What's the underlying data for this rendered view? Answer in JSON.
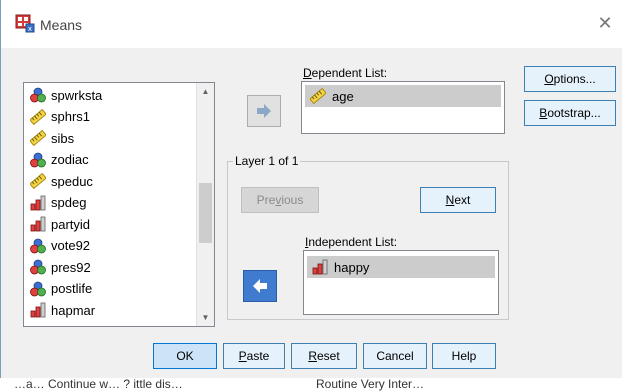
{
  "window": {
    "title": "Means"
  },
  "variables": [
    {
      "name": "spwrksta",
      "icon": "nominal-icon"
    },
    {
      "name": "sphrs1",
      "icon": "scale-icon"
    },
    {
      "name": "sibs",
      "icon": "scale-icon"
    },
    {
      "name": "zodiac",
      "icon": "nominal-icon"
    },
    {
      "name": "speduc",
      "icon": "scale-icon"
    },
    {
      "name": "spdeg",
      "icon": "ordinal-icon"
    },
    {
      "name": "partyid",
      "icon": "ordinal-icon"
    },
    {
      "name": "vote92",
      "icon": "nominal-icon"
    },
    {
      "name": "pres92",
      "icon": "nominal-icon"
    },
    {
      "name": "postlife",
      "icon": "nominal-icon"
    },
    {
      "name": "hapmar",
      "icon": "ordinal-icon"
    }
  ],
  "dependent": {
    "label_pre": "",
    "label_u": "D",
    "label_post": "ependent List:",
    "items": [
      {
        "name": "age",
        "icon": "scale-icon"
      }
    ]
  },
  "layer": {
    "label": "Layer 1 of 1",
    "previous_pre": "Pre",
    "previous_u": "v",
    "previous_post": "ious",
    "next_u": "N",
    "next_post": "ext"
  },
  "independent": {
    "label_u": "I",
    "label_post": "ndependent List:",
    "items": [
      {
        "name": "happy",
        "icon": "ordinal-icon"
      }
    ]
  },
  "side_buttons": {
    "options_u": "O",
    "options_post": "ptions...",
    "bootstrap_u": "B",
    "bootstrap_post": "ootstrap..."
  },
  "bottom_buttons": {
    "ok": "OK",
    "paste_u": "P",
    "paste_post": "aste",
    "reset_u": "R",
    "reset_post": "eset",
    "cancel": "Cancel",
    "help": "Help"
  },
  "background_text": {
    "left": "…a… Continue w… ? ittle dis…",
    "right": "Routine   Very Inter…"
  },
  "colors": {
    "accent": "#3f7cd0",
    "selection": "#cccccc",
    "button_focus_border": "#3c7fb1"
  }
}
